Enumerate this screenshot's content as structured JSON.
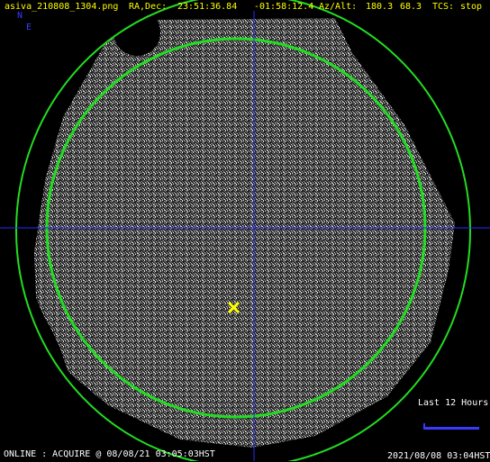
{
  "header": {
    "filename": "asiva_210808_1304.png",
    "radec_label": "RA,Dec:",
    "ra": "23:51:36.84",
    "dec": "-01:58:12.4",
    "azalt_label": "Az/Alt:",
    "az": "180.3",
    "alt": "68.3",
    "tcs_label": "TCS:",
    "tcs_state": "stop"
  },
  "compass": {
    "north": "N",
    "east": "E"
  },
  "legend": {
    "label": "Last 12 Hours"
  },
  "footer": {
    "status": "ONLINE : ACQUIRE @ 08/08/21 03:05:03HST",
    "timestamp": "2021/08/08 03:04HST"
  },
  "colors": {
    "header_text": "#ffff00",
    "crosshair": "#2a2aff",
    "horizon_circle": "#22dd22",
    "target_marker": "#ffff00",
    "track": "#3a3aff"
  },
  "icons": {
    "target": "x-marker-icon",
    "north_arrow": "compass-north",
    "east_arrow": "compass-east"
  }
}
